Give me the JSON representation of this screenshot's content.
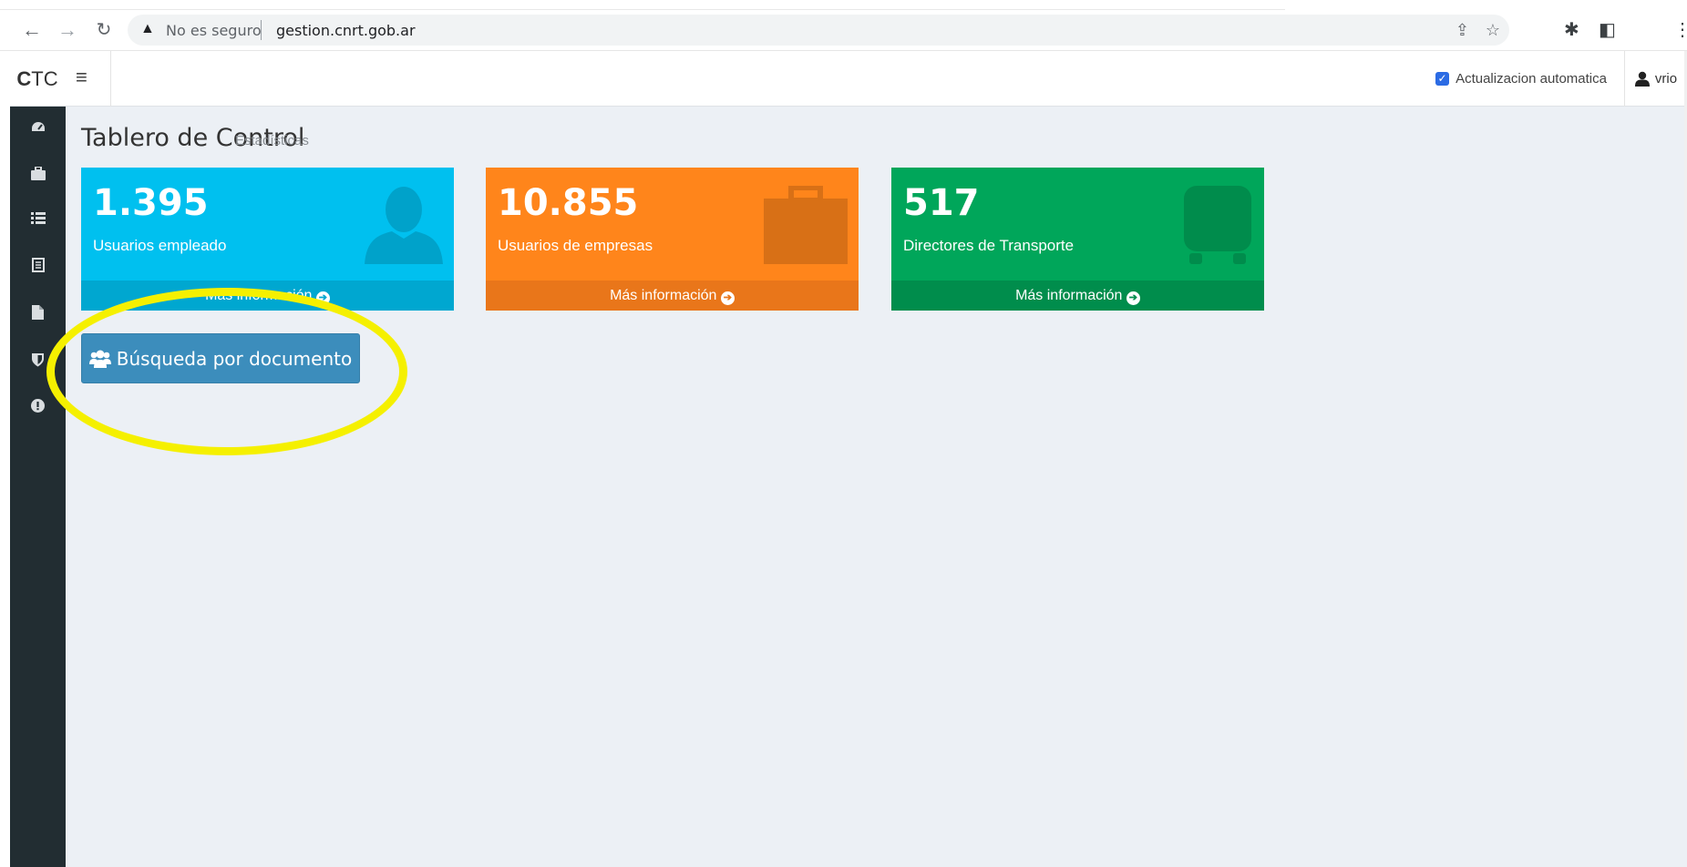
{
  "browser": {
    "security_text": "No es seguro",
    "url": "gestion.cnrt.gob.ar"
  },
  "header": {
    "logo_bold": "C",
    "logo_rest": "TC",
    "auto_update_label": "Actualizacion automatica",
    "auto_update_checked": true,
    "username": "vrio"
  },
  "sidebar": {
    "icons": [
      "dashboard-icon",
      "briefcase-icon",
      "list-icon",
      "book-icon",
      "file-icon",
      "shield-icon",
      "alert-icon"
    ]
  },
  "page": {
    "title": "Tablero de Control",
    "subtitle": "Estadísticas"
  },
  "stats": [
    {
      "value": "1.395",
      "label": "Usuarios empleado",
      "footer": "Más información",
      "color": "#00c0ef",
      "icon": "user-icon"
    },
    {
      "value": "10.855",
      "label": "Usuarios de empresas",
      "footer": "Más información",
      "color": "#ff851b",
      "icon": "briefcase-icon"
    },
    {
      "value": "517",
      "label": "Directores de Transporte",
      "footer": "Más información",
      "color": "#00a65a",
      "icon": "bus-icon"
    }
  ],
  "actions": {
    "search_button": "Búsqueda por documento"
  },
  "annotation": {
    "highlight_color": "#f5f000"
  }
}
